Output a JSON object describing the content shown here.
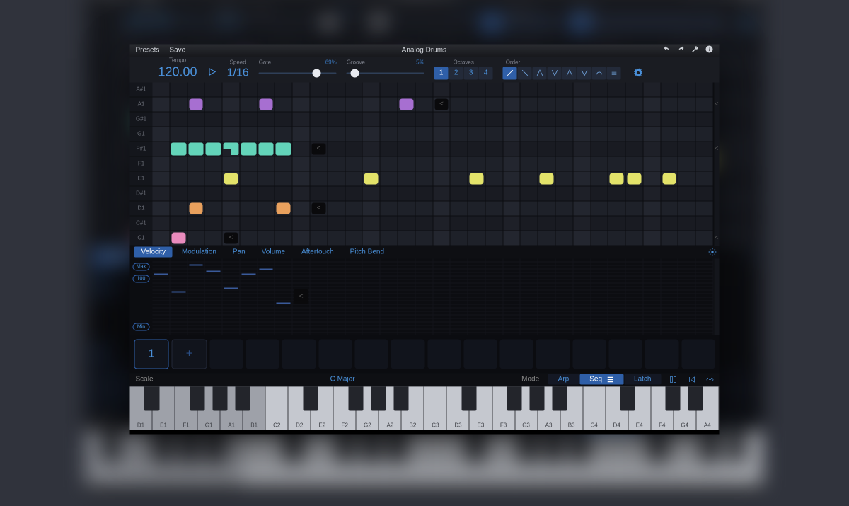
{
  "title": "Analog Drums",
  "menu": {
    "presets": "Presets",
    "save": "Save"
  },
  "transport": {
    "tempo_label": "Tempo",
    "tempo": "120.00",
    "speed_label": "Speed",
    "speed": "1/16",
    "gate_label": "Gate",
    "gate_pct": "69%",
    "gate_pos": 0.69,
    "groove_label": "Groove",
    "groove_pct": "5%",
    "groove_pos": 0.05,
    "oct_label": "Octaves",
    "octaves": [
      "1",
      "2",
      "3",
      "4"
    ],
    "oct_sel": 0,
    "order_label": "Order",
    "order_sel": 0
  },
  "rows": [
    "A#1",
    "A1",
    "G#1",
    "G1",
    "F#1",
    "F1",
    "E1",
    "D#1",
    "D1",
    "C#1",
    "C1"
  ],
  "cols": 32,
  "notes": [
    {
      "r": 1,
      "c": 2,
      "t": "purple"
    },
    {
      "r": 1,
      "c": 6,
      "t": "purple"
    },
    {
      "r": 1,
      "c": 14,
      "t": "purple"
    },
    {
      "r": 1,
      "c": 16,
      "t": "rest"
    },
    {
      "r": 4,
      "c": 1,
      "t": "teal"
    },
    {
      "r": 4,
      "c": 2,
      "t": "teal"
    },
    {
      "r": 4,
      "c": 3,
      "t": "teal"
    },
    {
      "r": 4,
      "c": 4,
      "t": "teal",
      "half": true
    },
    {
      "r": 4,
      "c": 5,
      "t": "teal"
    },
    {
      "r": 4,
      "c": 6,
      "t": "teal"
    },
    {
      "r": 4,
      "c": 7,
      "t": "teal"
    },
    {
      "r": 4,
      "c": 9,
      "t": "rest"
    },
    {
      "r": 6,
      "c": 4,
      "t": "yellow"
    },
    {
      "r": 6,
      "c": 12,
      "t": "yellow"
    },
    {
      "r": 6,
      "c": 18,
      "t": "yellow"
    },
    {
      "r": 6,
      "c": 22,
      "t": "yellow"
    },
    {
      "r": 6,
      "c": 26,
      "t": "yellow"
    },
    {
      "r": 6,
      "c": 27,
      "t": "yellow"
    },
    {
      "r": 6,
      "c": 29,
      "t": "yellow"
    },
    {
      "r": 8,
      "c": 2,
      "t": "orange"
    },
    {
      "r": 8,
      "c": 7,
      "t": "orange"
    },
    {
      "r": 8,
      "c": 9,
      "t": "rest"
    },
    {
      "r": 10,
      "c": 1,
      "t": "pink"
    },
    {
      "r": 10,
      "c": 4,
      "t": "rest"
    }
  ],
  "end_ticks": [
    1,
    4,
    10
  ],
  "param_tabs": [
    "Velocity",
    "Modulation",
    "Pan",
    "Volume",
    "Aftertouch",
    "Pitch Bend"
  ],
  "param_sel": 0,
  "vel": {
    "labels": [
      "Max",
      "100",
      "Min"
    ],
    "bars": [
      78,
      55,
      90,
      82,
      60,
      78,
      85,
      40
    ],
    "rest_at": 8
  },
  "patterns": {
    "current": "1",
    "add": "+",
    "slots": 16
  },
  "scale": {
    "label": "Scale",
    "value": "C Major"
  },
  "mode": {
    "label": "Mode",
    "options": [
      "Arp",
      "Seq",
      "Latch"
    ],
    "sel": 1
  },
  "keys": {
    "white": [
      "D1",
      "E1",
      "F1",
      "G1",
      "A1",
      "B1",
      "C2",
      "D2",
      "E2",
      "F2",
      "G2",
      "A2",
      "B2",
      "C3",
      "D3",
      "E3",
      "F3",
      "G3",
      "A3",
      "B3",
      "C4",
      "D4",
      "E4",
      "F4",
      "G4",
      "A4"
    ],
    "black_after": [
      0,
      2,
      3,
      4,
      7,
      9,
      10,
      11,
      14,
      16,
      17,
      18,
      21,
      23,
      24
    ],
    "dim": [
      0,
      1,
      2,
      3,
      4,
      5
    ]
  }
}
